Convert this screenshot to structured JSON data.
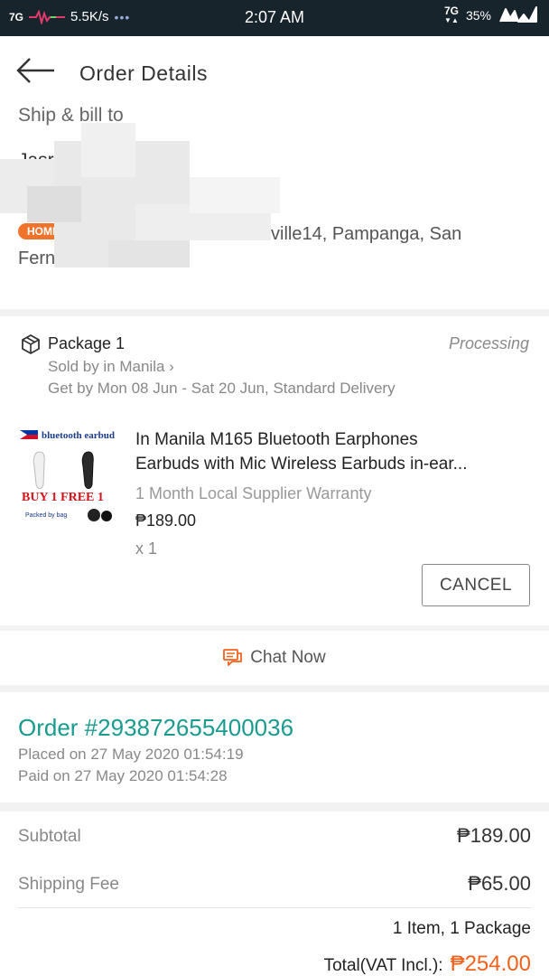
{
  "status_bar": {
    "network_left": "7G",
    "speed": "5.5K/s",
    "more": "•••",
    "time": "2:07 AM",
    "network_right": "7G",
    "battery": "35%"
  },
  "header": {
    "title": "Order Details"
  },
  "shipping": {
    "section_label": "Ship & bill to",
    "name_partial": "Jasr",
    "address_tag": "HOME",
    "address_line1_partial": "ville14, Pampanga, San",
    "address_line2_partial": "Fernando, Mai"
  },
  "package": {
    "name": "Package 1",
    "status": "Processing",
    "seller": "Sold by in Manila ›",
    "delivery": "Get by Mon 08 Jun - Sat 20 Jun, Standard Delivery",
    "product_title_line1": "In Manila M165 Bluetooth Earphones",
    "product_title_line2": "Earbuds with Mic Wireless Earbuds in-ear...",
    "warranty": "1 Month Local Supplier Warranty",
    "price": "₱189.00",
    "quantity": "x 1",
    "image_texts": {
      "top": "bluetooth earbud",
      "promo": "BUY 1 FREE 1",
      "packed": "Packed by bag"
    },
    "cancel_label": "CANCEL"
  },
  "chat": {
    "label": "Chat Now"
  },
  "order": {
    "number": "Order #293872655400036",
    "placed": "Placed on 27 May 2020  01:54:19",
    "paid": "Paid on 27 May 2020  01:54:28"
  },
  "summary": {
    "subtotal_label": "Subtotal",
    "subtotal_value": "₱189.00",
    "shipping_label": "Shipping Fee",
    "shipping_value": "₱65.00",
    "items": "1 Item, 1 Package",
    "total_label": "Total(VAT Incl.):",
    "total_value": "₱254.00"
  },
  "colors": {
    "accent_teal": "#1a9b8e",
    "accent_orange": "#f0611c",
    "status_bar_bg": "#18242c"
  }
}
